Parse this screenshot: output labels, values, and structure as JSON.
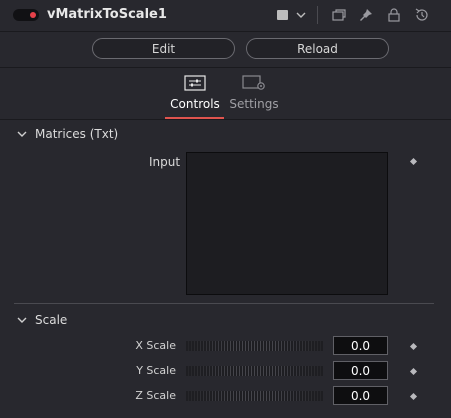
{
  "header": {
    "tool_name": "vMatrixToScale1",
    "swatch_color": "#bdbdbd",
    "icons": [
      "chevron-down-icon",
      "windows-icon",
      "pin-icon",
      "lock-icon",
      "reset-icon"
    ]
  },
  "toolbar": {
    "edit_label": "Edit",
    "reload_label": "Reload"
  },
  "tabs": [
    {
      "label": "Controls",
      "icon": "sliders-icon",
      "active": true
    },
    {
      "label": "Settings",
      "icon": "settings-icon",
      "active": false
    }
  ],
  "sections": {
    "matrices": {
      "title": "Matrices (Txt)",
      "input_label": "Input"
    },
    "scale": {
      "title": "Scale",
      "rows": [
        {
          "label": "X Scale",
          "value": "0.0"
        },
        {
          "label": "Y Scale",
          "value": "0.0"
        },
        {
          "label": "Z Scale",
          "value": "0.0"
        }
      ]
    }
  },
  "colors": {
    "accent": "#e0544e",
    "power_on": "#e6414a"
  }
}
